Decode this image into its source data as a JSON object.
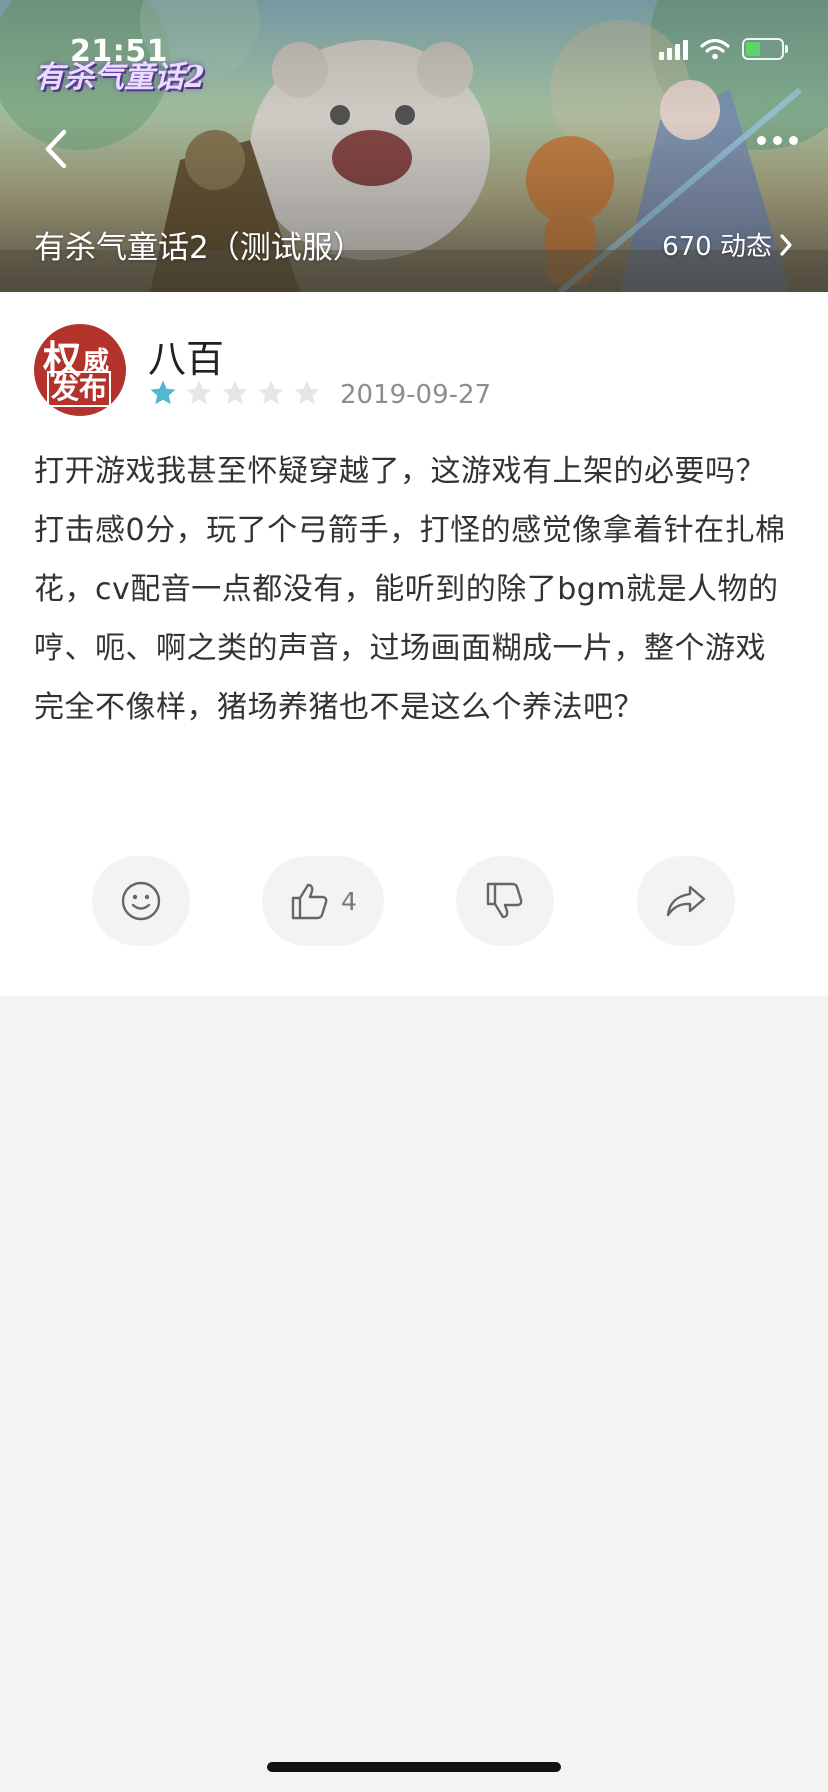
{
  "status_bar": {
    "time": "21:51"
  },
  "header": {
    "game_logo_text": "有杀气童话2",
    "game_title": "有杀气童话2（测试服）",
    "activity_count_label": "670 动态",
    "back_icon": "chevron-left-icon",
    "more_icon": "more-dots-icon",
    "activity_chevron_icon": "chevron-right-icon"
  },
  "review": {
    "avatar_text_1": "权",
    "avatar_text_2": "威",
    "avatar_text_3": "发布",
    "username": "八百",
    "rating": 1,
    "rating_max": 5,
    "date": "2019-09-27",
    "text": "打开游戏我甚至怀疑穿越了，这游戏有上架的必要吗？打击感0分，玩了个弓箭手，打怪的感觉像拿着针在扎棉花，cv配音一点都没有，能听到的除了bgm就是人物的哼、呃、啊之类的声音，过场画面糊成一片，整个游戏完全不像样，猪场养猪也不是这么个养法吧？"
  },
  "actions": {
    "emoji_icon": "smiley-icon",
    "like_icon": "thumbs-up-icon",
    "like_count": "4",
    "dislike_icon": "thumbs-down-icon",
    "share_icon": "share-arrow-icon"
  },
  "colors": {
    "star_active": "#4fb8cf",
    "star_inactive": "#e6e6e6",
    "page_background": "#f3f3f3",
    "card_background": "#ffffff",
    "avatar_red": "#b3322c"
  }
}
